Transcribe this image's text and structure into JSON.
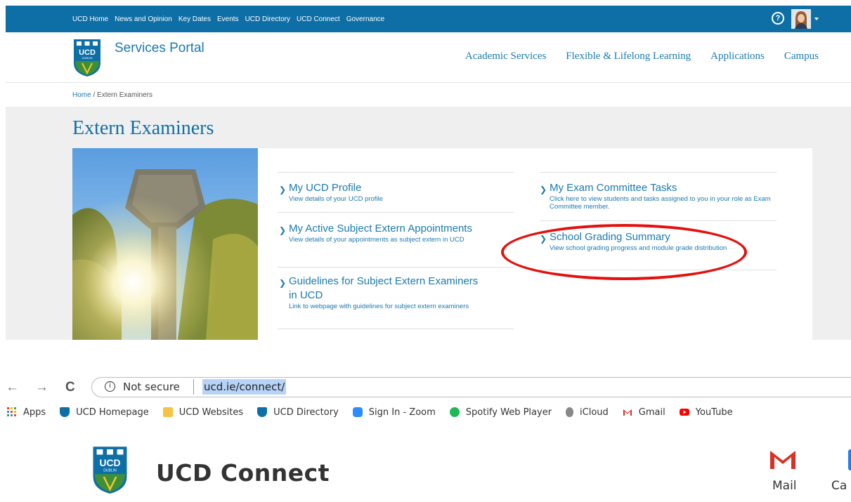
{
  "topbar": {
    "links": [
      "UCD Home",
      "News and Opinion",
      "Key Dates",
      "Events",
      "UCD Directory",
      "UCD Connect",
      "Governance"
    ],
    "help_symbol": "?"
  },
  "header": {
    "logo_text": "UCD",
    "logo_subtext": "DUBLIN",
    "portal_title": "Services Portal",
    "nav": [
      "Academic Services",
      "Flexible & Lifelong Learning",
      "Applications",
      "Campus"
    ]
  },
  "breadcrumb": {
    "home": "Home",
    "separator": "/",
    "current": "Extern Examiners"
  },
  "page": {
    "title": "Extern Examiners"
  },
  "services": {
    "left": [
      {
        "title": "My UCD Profile",
        "description": "View details of your UCD profile"
      },
      {
        "title": "My Active Subject Extern Appointments",
        "description": "View details of your appointments as subject extern in UCD"
      },
      {
        "title": "Guidelines for Subject Extern Examiners in UCD",
        "description": "Link to webpage with guidelines for subject extern examiners"
      }
    ],
    "right": [
      {
        "title": "My Exam Committee Tasks",
        "description": "Click here to view students and tasks assigned to you in your role as Exam Committee member."
      },
      {
        "title": "School Grading Summary",
        "description": "View school grading progress and module grade distribution"
      }
    ]
  },
  "browser": {
    "back": "←",
    "forward": "→",
    "reload": "C",
    "info": "i",
    "security_label": "Not secure",
    "url": "ucd.ie/connect/",
    "bookmarks": [
      "Apps",
      "UCD Homepage",
      "UCD Websites",
      "UCD Directory",
      "Sign In - Zoom",
      "Spotify Web Player",
      "iCloud",
      "Gmail",
      "YouTube"
    ]
  },
  "connect": {
    "title": "UCD Connect",
    "apps": [
      "Mail",
      "Ca"
    ]
  },
  "colors": {
    "ucd_blue": "#0e6fa6",
    "link_blue": "#1a7ab0",
    "annotation_red": "#e3100d",
    "band_grey": "#efefef"
  }
}
